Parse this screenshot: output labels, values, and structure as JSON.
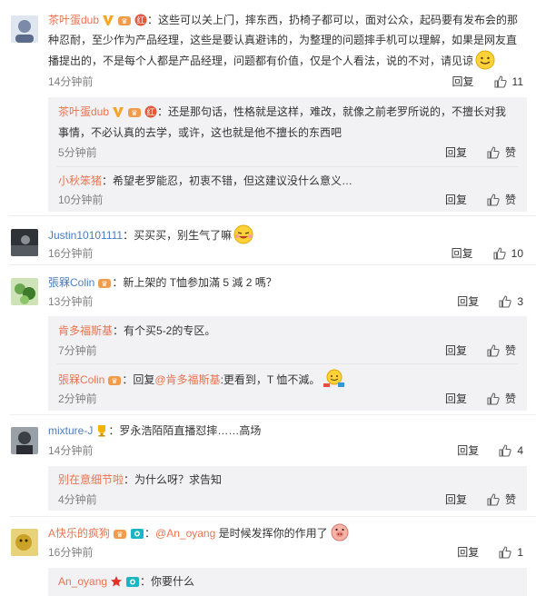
{
  "ui": {
    "reply": "回复",
    "like": "赞"
  },
  "comments": [
    {
      "user": "茶叶蛋dub",
      "text": "：这些可以关上门，摔东西，扔椅子都可以，面对公众，起码要有发布会的那",
      "text2": "种忍耐，至少作为产品经理，这些是要认真避讳的，为整理的问题摔手机可以理解，如果是网友直",
      "text3": "播提出的，不是每个人都是产品经理，问题都有价值，仅是个人看法，说的不对，请见谅",
      "time": "14分钟前",
      "likes": "11",
      "replies": [
        {
          "user": "茶叶蛋dub",
          "text": "：还是那句话，性格就是这样，难改，就像之前老罗所说的，不擅长对我",
          "text2": "事情，不必认真的去学，或许，这也就是他不擅长的东西吧",
          "time": "5分钟前"
        },
        {
          "user": "小秋笨猪",
          "text": "：希望老罗能忍，初衷不错，但这建议没什么意义…",
          "time": "10分钟前"
        }
      ]
    },
    {
      "user": "Justin10101111",
      "text": "：买买买，别生气了嘛",
      "time": "16分钟前",
      "likes": "10"
    },
    {
      "user": "張槑Colin",
      "text": "：新上架的 T恤参加滿 5 減 2 嗎？",
      "time": "13分钟前",
      "likes": "3",
      "replies": [
        {
          "user": "肯多福斯基",
          "text": "：有个买5-2的专区。",
          "time": "7分钟前"
        },
        {
          "user": "張槑Colin",
          "text_prefix": "：回复",
          "mention": "@肯多福斯基",
          "text": ":更看到，T 恤不減。",
          "time": "2分钟前"
        }
      ]
    },
    {
      "user": "mixture-J",
      "text": "：罗永浩陌陌直播怼摔……高场",
      "time": "14分钟前",
      "likes": "4",
      "replies": [
        {
          "user": "别在意细节啦",
          "text": "：为什么呀？求告知",
          "time": "4分钟前"
        }
      ]
    },
    {
      "user": "A快乐的疯狗",
      "mention": "@An_oyang",
      "text": " 是时候发挥你的作用了",
      "time": "16分钟前",
      "likes": "1",
      "replies": [
        {
          "user": "An_oyang",
          "text": "：你要什么"
        }
      ]
    }
  ],
  "colors": {
    "accent_orange": "#eb7350",
    "link_blue": "#4a7dbf",
    "sub_bg": "#f2f2f5",
    "muted": "#808080"
  }
}
